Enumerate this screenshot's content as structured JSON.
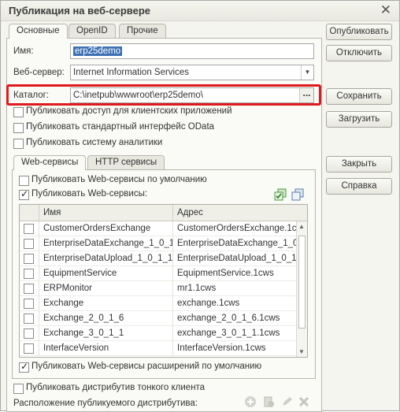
{
  "window": {
    "title": "Публикация на веб-сервере"
  },
  "tabs": {
    "main": "Основные",
    "openid": "OpenID",
    "other": "Прочие"
  },
  "form": {
    "name_label": "Имя:",
    "name_value": "erp25demo",
    "webserver_label": "Веб-сервер:",
    "webserver_value": "Internet Information Services",
    "catalog_label": "Каталог:",
    "catalog_value": "C:\\inetpub\\wwwroot\\erp25demo\\",
    "catalog_button": "..."
  },
  "options": [
    {
      "label": "Публиковать доступ для клиентских приложений",
      "checked": false
    },
    {
      "label": "Публиковать стандартный интерфейс OData",
      "checked": false
    },
    {
      "label": "Публиковать систему аналитики",
      "checked": false
    }
  ],
  "inner_tabs": {
    "web": "Web-сервисы",
    "http": "HTTP сервисы"
  },
  "web": {
    "publish_default": "Публиковать Web-сервисы по умолчанию",
    "publish_default_checked": false,
    "publish": "Публиковать Web-сервисы:",
    "publish_checked": true,
    "columns": {
      "name": "Имя",
      "address": "Адрес"
    },
    "rows": [
      {
        "name": "CustomerOrdersExchange",
        "address": "CustomerOrdersExchange.1c..."
      },
      {
        "name": "EnterpriseDataExchange_1_0_1...",
        "address": "EnterpriseDataExchange_1_0_..."
      },
      {
        "name": "EnterpriseDataUpload_1_0_1_1",
        "address": "EnterpriseDataUpload_1_0_1..."
      },
      {
        "name": "EquipmentService",
        "address": "EquipmentService.1cws"
      },
      {
        "name": "ERPMonitor",
        "address": "mr1.1cws"
      },
      {
        "name": "Exchange",
        "address": "exchange.1cws"
      },
      {
        "name": "Exchange_2_0_1_6",
        "address": "exchange_2_0_1_6.1cws"
      },
      {
        "name": "Exchange_3_0_1_1",
        "address": "exchange_3_0_1_1.1cws"
      },
      {
        "name": "InterfaceVersion",
        "address": "InterfaceVersion.1cws"
      }
    ],
    "publish_ext": "Публиковать Web-сервисы расширений по умолчанию",
    "publish_ext_checked": true
  },
  "bottom": {
    "thin_client": "Публиковать дистрибутив тонкого клиента",
    "thin_client_checked": false,
    "location": "Расположение публикуемого дистрибутива:"
  },
  "buttons": {
    "publish": "Опубликовать",
    "disable": "Отключить",
    "save": "Сохранить",
    "load": "Загрузить",
    "close": "Закрыть",
    "help": "Справка"
  },
  "colors": {
    "highlight": "#e0191d",
    "selection": "#3d6fb3",
    "table_icon": "#4a9a3c"
  }
}
